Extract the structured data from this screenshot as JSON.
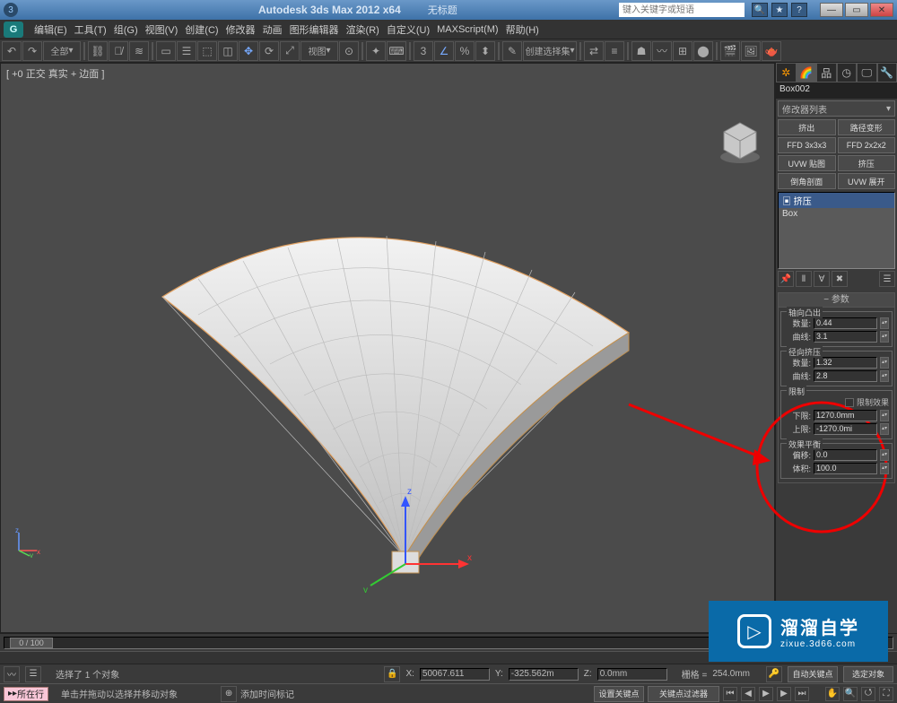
{
  "title": {
    "app": "Autodesk 3ds Max 2012 x64",
    "doc": "无标题"
  },
  "search_placeholder": "键入关键字或短语",
  "menu": [
    "编辑(E)",
    "工具(T)",
    "组(G)",
    "视图(V)",
    "创建(C)",
    "修改器",
    "动画",
    "图形编辑器",
    "渲染(R)",
    "自定义(U)",
    "MAXScript(M)",
    "帮助(H)"
  ],
  "toolbar_sel": {
    "sel_filter": "全部",
    "view": "视图",
    "create_sel": "创建选择集"
  },
  "viewport_label": "[ +0 正交 真实 + 边面 ]",
  "timeline": {
    "handle": "0 / 100"
  },
  "trackbar": {
    "label1": "选择了 1 个对象",
    "label2": "单击并拖动以选择并移动对象",
    "addkey": "添加时间标记"
  },
  "status": {
    "pink": "所在行",
    "x_label": "X:",
    "x": "50067.611",
    "y_label": "Y:",
    "y": "-325.562m",
    "z_label": "Z:",
    "z": "0.0mm",
    "grid_label": "栅格 =",
    "grid": "254.0mm",
    "autokey": "自动关键点",
    "selset": "选定对象",
    "setkey": "设置关键点",
    "keyfilter": "关键点过滤器"
  },
  "panel": {
    "objname": "Box002",
    "modlist": "修改器列表",
    "btns": [
      [
        "挤出",
        "路径变形"
      ],
      [
        "FFD 3x3x3",
        "FFD 2x2x2"
      ],
      [
        "UVW 贴图",
        "挤压"
      ],
      [
        "倒角剖面",
        "UVW 展开"
      ]
    ],
    "stack": {
      "sel": "挤压",
      "item": "Box",
      "bullet": "▣"
    },
    "rollout_title": "参数",
    "grp_axial": {
      "label": "轴向凸出",
      "amount_l": "数量:",
      "amount": "0.44",
      "curve_l": "曲线:",
      "curve": "3.1"
    },
    "grp_radial": {
      "label": "径向挤压",
      "amount_l": "数量:",
      "amount": "1.32",
      "curve_l": "曲线:",
      "curve": "2.8"
    },
    "grp_limit": {
      "label": "限制",
      "chk": "限制效果",
      "lower_l": "下限:",
      "lower": "1270.0mm",
      "upper_l": "上限:",
      "upper": "-1270.0mi"
    },
    "grp_balance": {
      "label": "效果平衡",
      "bias_l": "偏移:",
      "bias": "0.0",
      "vol_l": "体积:",
      "vol": "100.0"
    }
  },
  "watermark": {
    "big": "溜溜自学",
    "small": "zixue.3d66.com"
  }
}
